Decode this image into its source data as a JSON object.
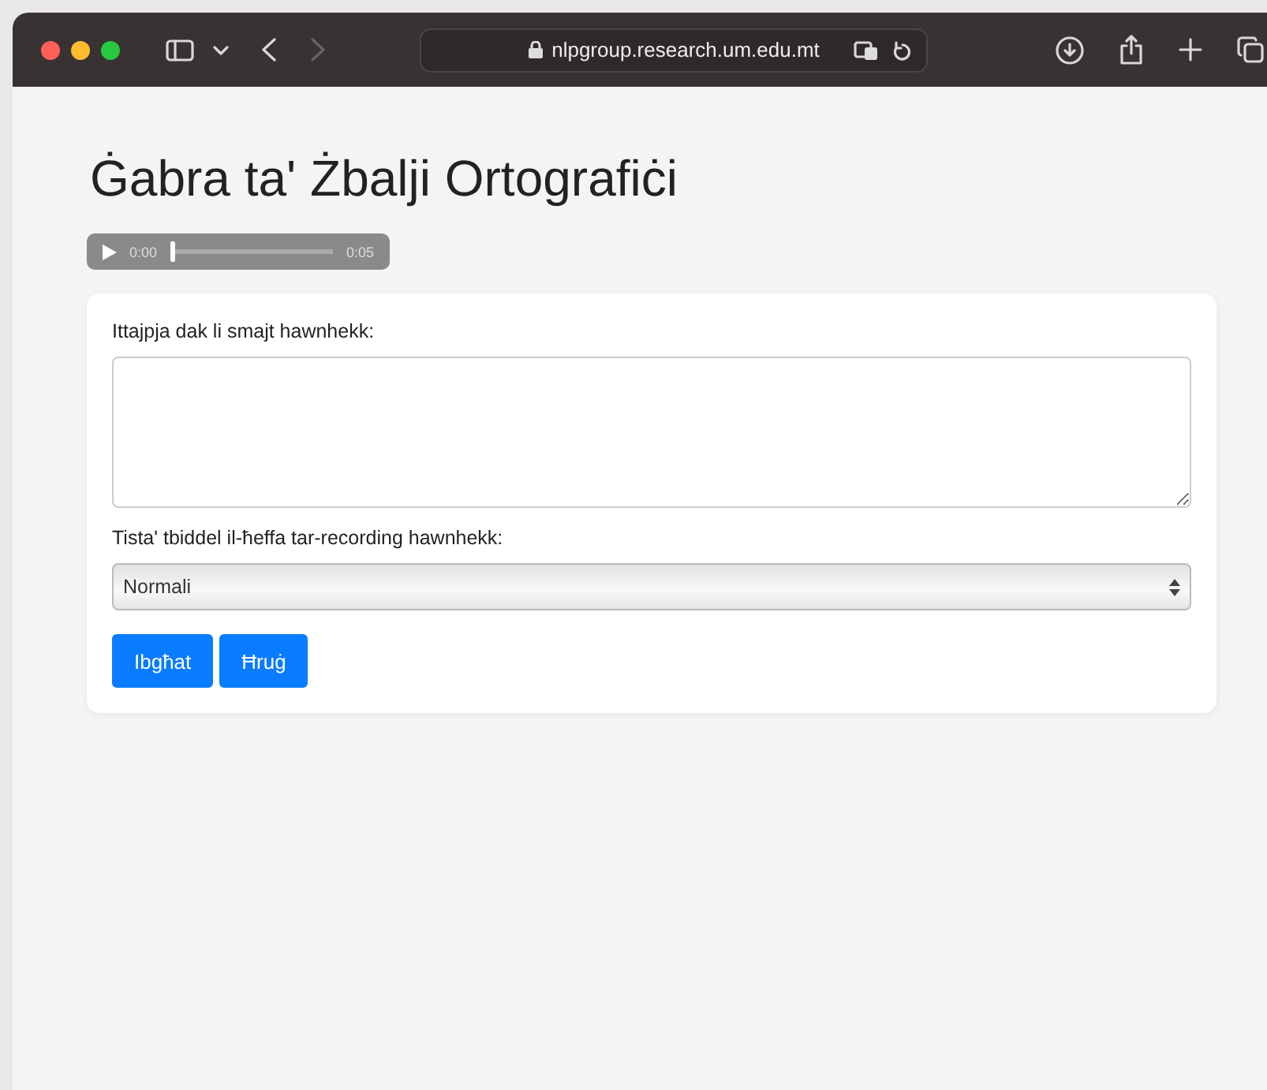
{
  "browser": {
    "url": "nlpgroup.research.um.edu.mt"
  },
  "page": {
    "title": "Ġabra ta' Żbalji Ortografiċi",
    "audio": {
      "current_time": "0:00",
      "duration": "0:05",
      "level": 0
    },
    "form": {
      "text_label": "Ittajpja dak li smajt hawnhekk:",
      "speed_label": "Tista' tbiddel il-ħeffa tar-recording hawnhekk:",
      "speed_value": "Normali",
      "buttons": [
        {
          "label": "Ibgħat"
        },
        {
          "label": "Ħruġ"
        }
      ]
    }
  }
}
